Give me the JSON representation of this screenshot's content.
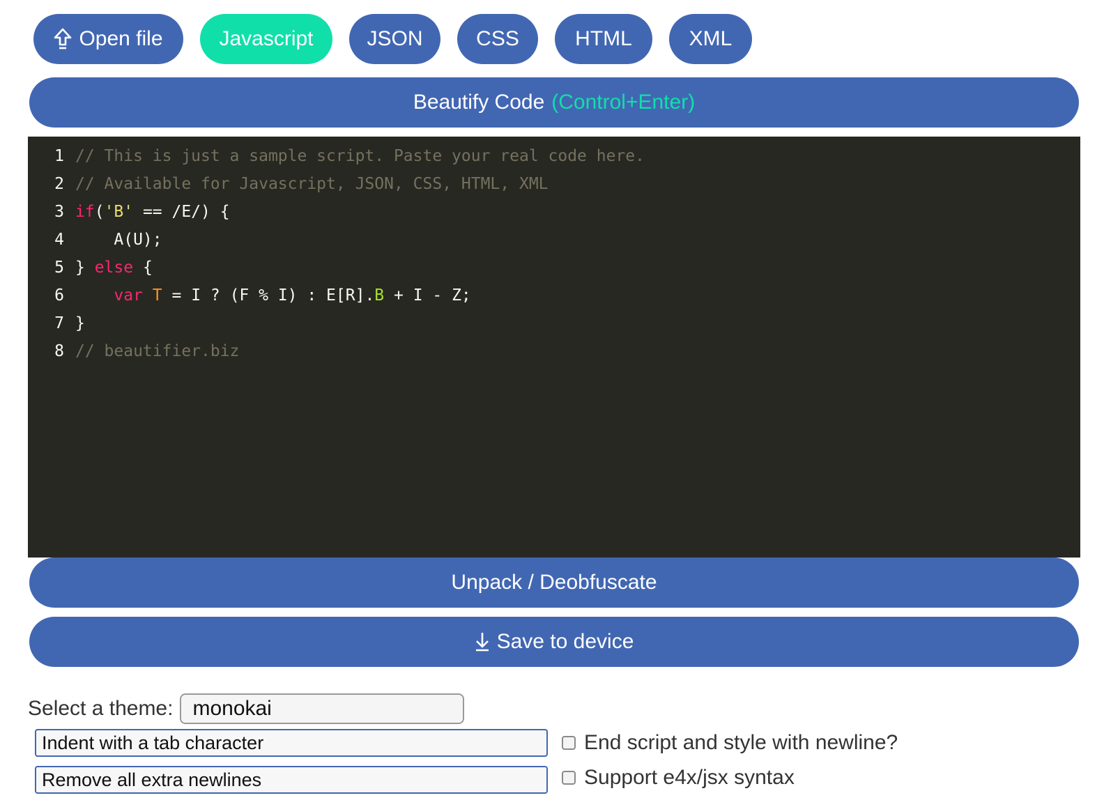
{
  "languages": [
    {
      "label": "Open file",
      "icon": "upload-icon"
    },
    {
      "label": "Javascript",
      "active": true
    },
    {
      "label": "JSON"
    },
    {
      "label": "CSS"
    },
    {
      "label": "HTML"
    },
    {
      "label": "XML"
    }
  ],
  "beautify": {
    "label": "Beautify Code",
    "shortcut": "(Control+Enter)"
  },
  "editor": {
    "line_numbers": [
      "1",
      "2",
      "3",
      "4",
      "5",
      "6",
      "7",
      "8"
    ],
    "lines": [
      "// This is just a sample script. Paste your real code here.",
      "// Available for Javascript, JSON, CSS, HTML, XML",
      "if('B' == /E/) {",
      "    A(U);",
      "} else {",
      "    var T = I ? (F % I) : E[R].B + I - Z;",
      "}",
      "// beautifier.biz"
    ],
    "tokens": {
      "line1": "// This is just a sample script. Paste your real code here.",
      "line2": "// Available for Javascript, JSON, CSS, HTML, XML",
      "line3_kw": "if",
      "line3_open": "(",
      "line3_str": "'B'",
      "line3_rest": " == /E/) {",
      "line4": "    A(U);",
      "line5_open": "} ",
      "line5_kw": "else",
      "line5_rest": " {",
      "line6_indent": "    ",
      "line6_kw": "var",
      "line6_sp": " ",
      "line6_var": "T",
      "line6_mid": " = I ? (F % I) : E[R].",
      "line6_prop": "B",
      "line6_rest": " + I - Z;",
      "line7": "}",
      "line8": "// beautifier.biz"
    },
    "colors": {
      "background": "#272822",
      "comment": "#75715e",
      "keyword": "#f92672",
      "string": "#e6db74",
      "variable": "#fd971f",
      "property": "#a6e22e"
    }
  },
  "unpack": {
    "label": "Unpack / Deobfuscate"
  },
  "save": {
    "label": "Save to device",
    "icon": "download-icon"
  },
  "theme": {
    "label": "Select a theme:",
    "value": "monokai"
  },
  "options": {
    "indent": "Indent with a tab character",
    "newlines": "Remove all extra newlines",
    "end_newline": "End script and style with newline?",
    "e4x": "Support e4x/jsx syntax"
  },
  "colors": {
    "primary": "#4267b2",
    "accent": "#10dfaa"
  }
}
